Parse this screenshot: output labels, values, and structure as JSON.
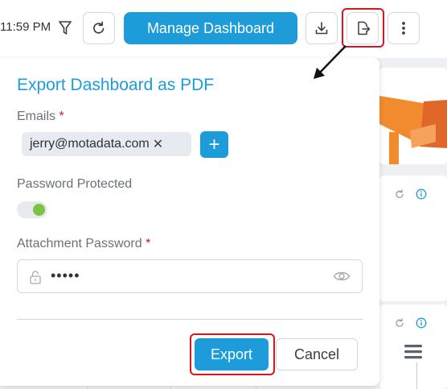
{
  "toolbar": {
    "time": "11:59 PM",
    "filter_icon": "filter-icon",
    "refresh_icon": "refresh-icon",
    "manage_label": "Manage Dashboard",
    "download_icon": "download-icon",
    "export_icon": "export-file-icon",
    "more_icon": "more-vertical-icon"
  },
  "dialog": {
    "title": "Export Dashboard as PDF",
    "emails_label": "Emails",
    "required_mark": "*",
    "email_chip": "jerry@motadata.com",
    "chip_remove": "✕",
    "add_symbol": "+",
    "password_protected_label": "Password Protected",
    "password_protected_on": true,
    "attachment_password_label": "Attachment Password",
    "password_value": "•••••",
    "export_label": "Export",
    "cancel_label": "Cancel"
  },
  "colors": {
    "accent": "#1e9bd9",
    "highlight": "#d8161f",
    "toggle_on": "#7cc243",
    "widget_orange": "#f28a2e"
  }
}
